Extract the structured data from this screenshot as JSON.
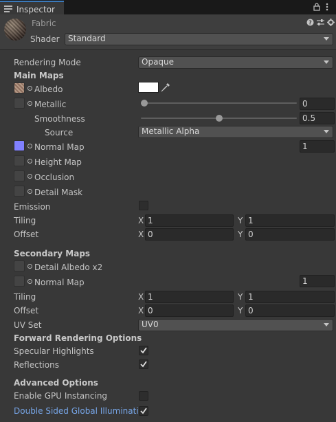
{
  "tab": {
    "label": "Inspector"
  },
  "material": {
    "name": "Fabric",
    "shader_label": "Shader",
    "shader_value": "Standard"
  },
  "rendering_mode": {
    "label": "Rendering Mode",
    "value": "Opaque"
  },
  "main_maps": {
    "heading": "Main Maps",
    "albedo": "Albedo",
    "metallic": {
      "label": "Metallic",
      "value": "0",
      "level": 0.0
    },
    "smoothness": {
      "label": "Smoothness",
      "value": "0.5",
      "level": 0.5
    },
    "source": {
      "label": "Source",
      "value": "Metallic Alpha"
    },
    "normal_map": {
      "label": "Normal Map",
      "value": "1"
    },
    "height_map": "Height Map",
    "occlusion": "Occlusion",
    "detail_mask": "Detail Mask",
    "emission": "Emission",
    "tiling": {
      "label": "Tiling",
      "x_label": "X",
      "x": "1",
      "y_label": "Y",
      "y": "1"
    },
    "offset": {
      "label": "Offset",
      "x_label": "X",
      "x": "0",
      "y_label": "Y",
      "y": "0"
    }
  },
  "secondary_maps": {
    "heading": "Secondary Maps",
    "detail_albedo": "Detail Albedo x2",
    "normal_map": {
      "label": "Normal Map",
      "value": "1"
    },
    "tiling": {
      "label": "Tiling",
      "x_label": "X",
      "x": "1",
      "y_label": "Y",
      "y": "1"
    },
    "offset": {
      "label": "Offset",
      "x_label": "X",
      "x": "0",
      "y_label": "Y",
      "y": "0"
    },
    "uv_set": {
      "label": "UV Set",
      "value": "UV0"
    }
  },
  "forward_rendering": {
    "heading": "Forward Rendering Options",
    "specular_highlights": "Specular Highlights",
    "reflections": "Reflections"
  },
  "advanced": {
    "heading": "Advanced Options",
    "gpu_instancing": "Enable GPU Instancing",
    "double_sided_gi": "Double Sided Global Illumination"
  },
  "colors": {
    "accent": "#3a79bb",
    "albedo_color": "#ffffff",
    "normal_swatch": "#8080ff",
    "link": "#77a6e8"
  }
}
